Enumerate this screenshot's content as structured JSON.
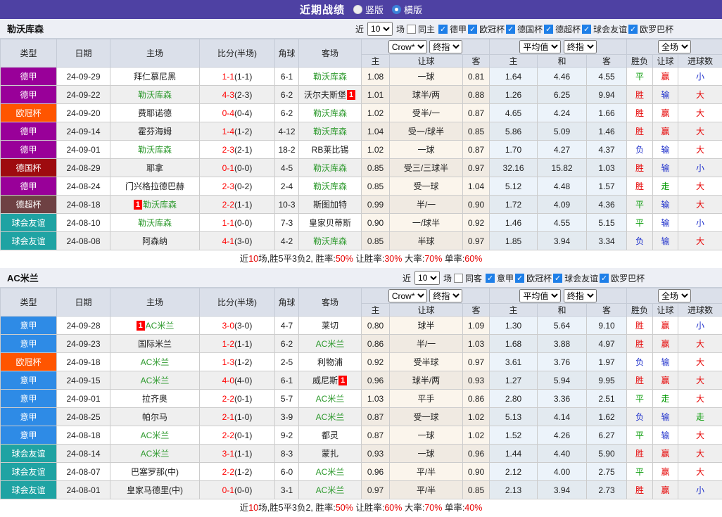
{
  "title_bar": {
    "title": "近期战绩",
    "radio_vertical": "竖版",
    "radio_horizontal": "横版"
  },
  "league_colors": {
    "德甲": "#990099",
    "欧冠杯": "#FF5500",
    "德国杯": "#9E0B0F",
    "德超杯": "#6E4143",
    "球会友谊": "#1FA3A3",
    "意甲": "#2E8BE6"
  },
  "status_colors": {
    "胜": "#E60000",
    "平": "#009900",
    "负": "#2233CC",
    "赢": "#E60000",
    "输": "#2233CC",
    "走": "#009900",
    "大": "#E60000",
    "小": "#2233CC"
  },
  "table_header": {
    "type": "类型",
    "date": "日期",
    "home": "主场",
    "score": "比分(半场)",
    "corner": "角球",
    "away": "客场",
    "odds_source": "Crow*",
    "odds_stage": "终指",
    "avg_source": "平均值",
    "avg_stage": "终指",
    "scope": "全场",
    "sub": [
      "主",
      "让球",
      "客",
      "主",
      "和",
      "客",
      "胜负",
      "让球",
      "进球数"
    ]
  },
  "sections": [
    {
      "team": "勒沃库森",
      "filter": {
        "near": "近",
        "count": "10",
        "games": "场",
        "same": "同主",
        "same_checked": false,
        "leagues": [
          "德甲",
          "欧冠杯",
          "德国杯",
          "德超杯",
          "球会友谊",
          "欧罗巴杯"
        ]
      },
      "rows": [
        {
          "league": "德甲",
          "date": "24-09-29",
          "home": "拜仁慕尼黑",
          "home_green": false,
          "home_badge": null,
          "ft": "1-1",
          "ht": "(1-1)",
          "corner": "6-1",
          "away": "勒沃库森",
          "away_green": true,
          "away_badge": null,
          "odds": [
            "1.08",
            "一球",
            "0.81"
          ],
          "avg": [
            "1.64",
            "4.46",
            "4.55"
          ],
          "result": "平",
          "hcp": "赢",
          "goals": "小"
        },
        {
          "league": "德甲",
          "date": "24-09-22",
          "home": "勒沃库森",
          "home_green": true,
          "home_badge": null,
          "ft": "4-3",
          "ht": "(2-3)",
          "corner": "6-2",
          "away": "沃尔夫斯堡",
          "away_green": false,
          "away_badge": {
            "pos": "after",
            "text": "1"
          },
          "odds": [
            "1.01",
            "球半/两",
            "0.88"
          ],
          "avg": [
            "1.26",
            "6.25",
            "9.94"
          ],
          "result": "胜",
          "hcp": "输",
          "goals": "大"
        },
        {
          "league": "欧冠杯",
          "date": "24-09-20",
          "home": "费耶诺德",
          "home_green": false,
          "home_badge": null,
          "ft": "0-4",
          "ht": "(0-4)",
          "corner": "6-2",
          "away": "勒沃库森",
          "away_green": true,
          "away_badge": null,
          "odds": [
            "1.02",
            "受半/一",
            "0.87"
          ],
          "avg": [
            "4.65",
            "4.24",
            "1.66"
          ],
          "result": "胜",
          "hcp": "赢",
          "goals": "大"
        },
        {
          "league": "德甲",
          "date": "24-09-14",
          "home": "霍芬海姆",
          "home_green": false,
          "home_badge": null,
          "ft": "1-4",
          "ht": "(1-2)",
          "corner": "4-12",
          "away": "勒沃库森",
          "away_green": true,
          "away_badge": null,
          "odds": [
            "1.04",
            "受一/球半",
            "0.85"
          ],
          "avg": [
            "5.86",
            "5.09",
            "1.46"
          ],
          "result": "胜",
          "hcp": "赢",
          "goals": "大"
        },
        {
          "league": "德甲",
          "date": "24-09-01",
          "home": "勒沃库森",
          "home_green": true,
          "home_badge": null,
          "ft": "2-3",
          "ht": "(2-1)",
          "corner": "18-2",
          "away": "RB莱比锡",
          "away_green": false,
          "away_badge": null,
          "odds": [
            "1.02",
            "一球",
            "0.87"
          ],
          "avg": [
            "1.70",
            "4.27",
            "4.37"
          ],
          "result": "负",
          "hcp": "输",
          "goals": "大"
        },
        {
          "league": "德国杯",
          "date": "24-08-29",
          "home": "耶拿",
          "home_green": false,
          "home_badge": null,
          "ft": "0-1",
          "ht": "(0-0)",
          "corner": "4-5",
          "away": "勒沃库森",
          "away_green": true,
          "away_badge": null,
          "odds": [
            "0.85",
            "受三/三球半",
            "0.97"
          ],
          "avg": [
            "32.16",
            "15.82",
            "1.03"
          ],
          "result": "胜",
          "hcp": "输",
          "goals": "小"
        },
        {
          "league": "德甲",
          "date": "24-08-24",
          "home": "门兴格拉德巴赫",
          "home_green": false,
          "home_badge": null,
          "ft": "2-3",
          "ht": "(0-2)",
          "corner": "2-4",
          "away": "勒沃库森",
          "away_green": true,
          "away_badge": null,
          "odds": [
            "0.85",
            "受一球",
            "1.04"
          ],
          "avg": [
            "5.12",
            "4.48",
            "1.57"
          ],
          "result": "胜",
          "hcp": "走",
          "goals": "大"
        },
        {
          "league": "德超杯",
          "date": "24-08-18",
          "home": "勒沃库森",
          "home_green": true,
          "home_badge": {
            "pos": "before",
            "text": "1"
          },
          "ft": "2-2",
          "ht": "(1-1)",
          "corner": "10-3",
          "away": "斯图加特",
          "away_green": false,
          "away_badge": null,
          "odds": [
            "0.99",
            "半/一",
            "0.90"
          ],
          "avg": [
            "1.72",
            "4.09",
            "4.36"
          ],
          "result": "平",
          "hcp": "输",
          "goals": "大"
        },
        {
          "league": "球会友谊",
          "date": "24-08-10",
          "home": "勒沃库森",
          "home_green": true,
          "home_badge": null,
          "ft": "1-1",
          "ht": "(0-0)",
          "corner": "7-3",
          "away": "皇家贝蒂斯",
          "away_green": false,
          "away_badge": null,
          "odds": [
            "0.90",
            "一/球半",
            "0.92"
          ],
          "avg": [
            "1.46",
            "4.55",
            "5.15"
          ],
          "result": "平",
          "hcp": "输",
          "goals": "小"
        },
        {
          "league": "球会友谊",
          "date": "24-08-08",
          "home": "阿森纳",
          "home_green": false,
          "home_badge": null,
          "ft": "4-1",
          "ht": "(3-0)",
          "corner": "4-2",
          "away": "勒沃库森",
          "away_green": true,
          "away_badge": null,
          "odds": [
            "0.85",
            "半球",
            "0.97"
          ],
          "avg": [
            "1.85",
            "3.94",
            "3.34"
          ],
          "result": "负",
          "hcp": "输",
          "goals": "大"
        }
      ],
      "summary": [
        {
          "text": "近",
          "red": false
        },
        {
          "text": "10",
          "red": true
        },
        {
          "text": "场,胜5平3负2, 胜率:",
          "red": false
        },
        {
          "text": "50%",
          "red": true
        },
        {
          "text": " 让胜率:",
          "red": false
        },
        {
          "text": "30%",
          "red": true
        },
        {
          "text": " 大率:",
          "red": false
        },
        {
          "text": "70%",
          "red": true
        },
        {
          "text": " 单率:",
          "red": false
        },
        {
          "text": "60%",
          "red": true
        }
      ]
    },
    {
      "team": "AC米兰",
      "filter": {
        "near": "近",
        "count": "10",
        "games": "场",
        "same": "同客",
        "same_checked": false,
        "leagues": [
          "意甲",
          "欧冠杯",
          "球会友谊",
          "欧罗巴杯"
        ]
      },
      "rows": [
        {
          "league": "意甲",
          "date": "24-09-28",
          "home": "AC米兰",
          "home_green": true,
          "home_badge": {
            "pos": "before",
            "text": "1"
          },
          "ft": "3-0",
          "ht": "(3-0)",
          "corner": "4-7",
          "away": "莱切",
          "away_green": false,
          "away_badge": null,
          "odds": [
            "0.80",
            "球半",
            "1.09"
          ],
          "avg": [
            "1.30",
            "5.64",
            "9.10"
          ],
          "result": "胜",
          "hcp": "赢",
          "goals": "小"
        },
        {
          "league": "意甲",
          "date": "24-09-23",
          "home": "国际米兰",
          "home_green": false,
          "home_badge": null,
          "ft": "1-2",
          "ht": "(1-1)",
          "corner": "6-2",
          "away": "AC米兰",
          "away_green": true,
          "away_badge": null,
          "odds": [
            "0.86",
            "半/一",
            "1.03"
          ],
          "avg": [
            "1.68",
            "3.88",
            "4.97"
          ],
          "result": "胜",
          "hcp": "赢",
          "goals": "大"
        },
        {
          "league": "欧冠杯",
          "date": "24-09-18",
          "home": "AC米兰",
          "home_green": true,
          "home_badge": null,
          "ft": "1-3",
          "ht": "(1-2)",
          "corner": "2-5",
          "away": "利物浦",
          "away_green": false,
          "away_badge": null,
          "odds": [
            "0.92",
            "受半球",
            "0.97"
          ],
          "avg": [
            "3.61",
            "3.76",
            "1.97"
          ],
          "result": "负",
          "hcp": "输",
          "goals": "大"
        },
        {
          "league": "意甲",
          "date": "24-09-15",
          "home": "AC米兰",
          "home_green": true,
          "home_badge": null,
          "ft": "4-0",
          "ht": "(4-0)",
          "corner": "6-1",
          "away": "威尼斯",
          "away_green": false,
          "away_badge": {
            "pos": "after",
            "text": "1"
          },
          "odds": [
            "0.96",
            "球半/两",
            "0.93"
          ],
          "avg": [
            "1.27",
            "5.94",
            "9.95"
          ],
          "result": "胜",
          "hcp": "赢",
          "goals": "大"
        },
        {
          "league": "意甲",
          "date": "24-09-01",
          "home": "拉齐奥",
          "home_green": false,
          "home_badge": null,
          "ft": "2-2",
          "ht": "(0-1)",
          "corner": "5-7",
          "away": "AC米兰",
          "away_green": true,
          "away_badge": null,
          "odds": [
            "1.03",
            "平手",
            "0.86"
          ],
          "avg": [
            "2.80",
            "3.36",
            "2.51"
          ],
          "result": "平",
          "hcp": "走",
          "goals": "大"
        },
        {
          "league": "意甲",
          "date": "24-08-25",
          "home": "帕尔马",
          "home_green": false,
          "home_badge": null,
          "ft": "2-1",
          "ht": "(1-0)",
          "corner": "3-9",
          "away": "AC米兰",
          "away_green": true,
          "away_badge": null,
          "odds": [
            "0.87",
            "受一球",
            "1.02"
          ],
          "avg": [
            "5.13",
            "4.14",
            "1.62"
          ],
          "result": "负",
          "hcp": "输",
          "goals": "走"
        },
        {
          "league": "意甲",
          "date": "24-08-18",
          "home": "AC米兰",
          "home_green": true,
          "home_badge": null,
          "ft": "2-2",
          "ht": "(0-1)",
          "corner": "9-2",
          "away": "都灵",
          "away_green": false,
          "away_badge": null,
          "odds": [
            "0.87",
            "一球",
            "1.02"
          ],
          "avg": [
            "1.52",
            "4.26",
            "6.27"
          ],
          "result": "平",
          "hcp": "输",
          "goals": "大"
        },
        {
          "league": "球会友谊",
          "date": "24-08-14",
          "home": "AC米兰",
          "home_green": true,
          "home_badge": null,
          "ft": "3-1",
          "ht": "(1-1)",
          "corner": "8-3",
          "away": "蒙扎",
          "away_green": false,
          "away_badge": null,
          "odds": [
            "0.93",
            "一球",
            "0.96"
          ],
          "avg": [
            "1.44",
            "4.40",
            "5.90"
          ],
          "result": "胜",
          "hcp": "赢",
          "goals": "大"
        },
        {
          "league": "球会友谊",
          "date": "24-08-07",
          "home": "巴塞罗那(中)",
          "home_green": false,
          "home_badge": null,
          "ft": "2-2",
          "ht": "(1-2)",
          "corner": "6-0",
          "away": "AC米兰",
          "away_green": true,
          "away_badge": null,
          "odds": [
            "0.96",
            "平/半",
            "0.90"
          ],
          "avg": [
            "2.12",
            "4.00",
            "2.75"
          ],
          "result": "平",
          "hcp": "赢",
          "goals": "大"
        },
        {
          "league": "球会友谊",
          "date": "24-08-01",
          "home": "皇家马德里(中)",
          "home_green": false,
          "home_badge": null,
          "ft": "0-1",
          "ht": "(0-0)",
          "corner": "3-1",
          "away": "AC米兰",
          "away_green": true,
          "away_badge": null,
          "odds": [
            "0.97",
            "平/半",
            "0.85"
          ],
          "avg": [
            "2.13",
            "3.94",
            "2.73"
          ],
          "result": "胜",
          "hcp": "赢",
          "goals": "小"
        }
      ],
      "summary": [
        {
          "text": "近",
          "red": false
        },
        {
          "text": "10",
          "red": true
        },
        {
          "text": "场,胜5平3负2, 胜率:",
          "red": false
        },
        {
          "text": "50%",
          "red": true
        },
        {
          "text": " 让胜率:",
          "red": false
        },
        {
          "text": "60%",
          "red": true
        },
        {
          "text": " 大率:",
          "red": false
        },
        {
          "text": "70%",
          "red": true
        },
        {
          "text": " 单率:",
          "red": false
        },
        {
          "text": "40%",
          "red": true
        }
      ]
    }
  ]
}
